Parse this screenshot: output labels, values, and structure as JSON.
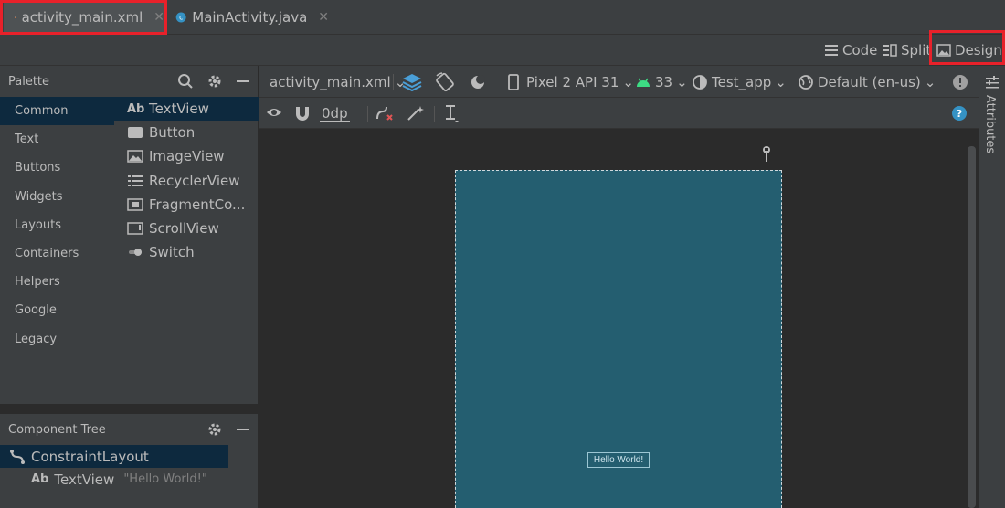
{
  "tabs": [
    {
      "label": "activity_main.xml",
      "icon": "xml-file-icon",
      "active": true
    },
    {
      "label": "MainActivity.java",
      "icon": "java-class-icon",
      "active": false
    }
  ],
  "modes": {
    "code": "Code",
    "split": "Split",
    "design": "Design"
  },
  "palette": {
    "title": "Palette",
    "categories": [
      "Common",
      "Text",
      "Buttons",
      "Widgets",
      "Layouts",
      "Containers",
      "Helpers",
      "Google",
      "Legacy"
    ],
    "items": [
      {
        "label": "TextView",
        "icon": "textview-icon"
      },
      {
        "label": "Button",
        "icon": "button-icon"
      },
      {
        "label": "ImageView",
        "icon": "imageview-icon"
      },
      {
        "label": "RecyclerView",
        "icon": "recyclerview-icon"
      },
      {
        "label": "FragmentCo...",
        "icon": "fragment-icon"
      },
      {
        "label": "ScrollView",
        "icon": "scrollview-icon"
      },
      {
        "label": "Switch",
        "icon": "switch-icon"
      }
    ]
  },
  "tree": {
    "title": "Component Tree",
    "root": "ConstraintLayout",
    "child": {
      "label": "TextView",
      "value": "\"Hello World!\""
    }
  },
  "toolbar": {
    "file": "activity_main.xml",
    "device": "Pixel 2 API 31",
    "api": "33",
    "theme": "Test_app",
    "locale": "Default (en-us)",
    "margin": "0dp"
  },
  "canvas": {
    "hello_text": "Hello World!"
  },
  "right_strip": {
    "attributes": "Attributes"
  },
  "colors": {
    "accent_red": "#e8212a",
    "device_bg": "#245e70",
    "selection": "#0d293e"
  }
}
